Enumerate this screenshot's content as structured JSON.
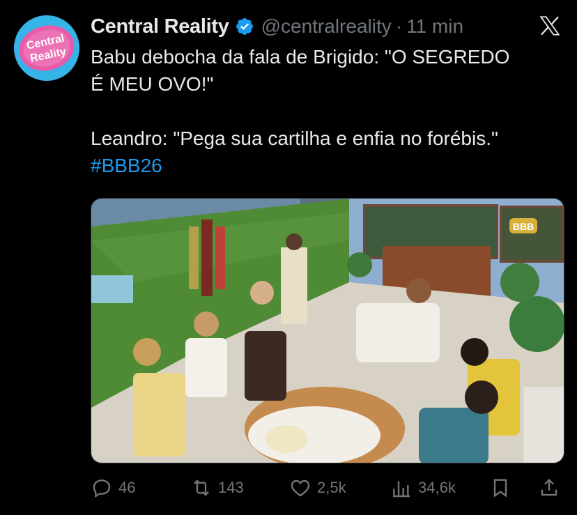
{
  "tweet": {
    "display_name": "Central Reality",
    "handle": "@centralreality",
    "separator": "·",
    "time": "11 min",
    "lines": [
      "Babu debocha da fala de Brigido: \"O SEGREDO",
      "É MEU OVO!\"",
      "",
      "Leandro: \"Pega sua cartilha e enfia no forébis.\""
    ],
    "hashtag": "#BBB26",
    "avatar_text_line1": "Central",
    "avatar_text_line2": "Reality",
    "media_logo_text": "BBB"
  },
  "actions": {
    "replies": "46",
    "reposts": "143",
    "likes": "2,5k",
    "views": "34,6k"
  },
  "colors": {
    "background": "#000000",
    "text": "#e7e9ea",
    "muted": "#71767b",
    "link": "#1d9bf0",
    "verified": "#1d9bf0"
  },
  "icons": [
    "verified-badge-icon",
    "x-logo-icon",
    "reply-icon",
    "repost-icon",
    "like-icon",
    "views-icon",
    "bookmark-icon",
    "share-icon"
  ]
}
